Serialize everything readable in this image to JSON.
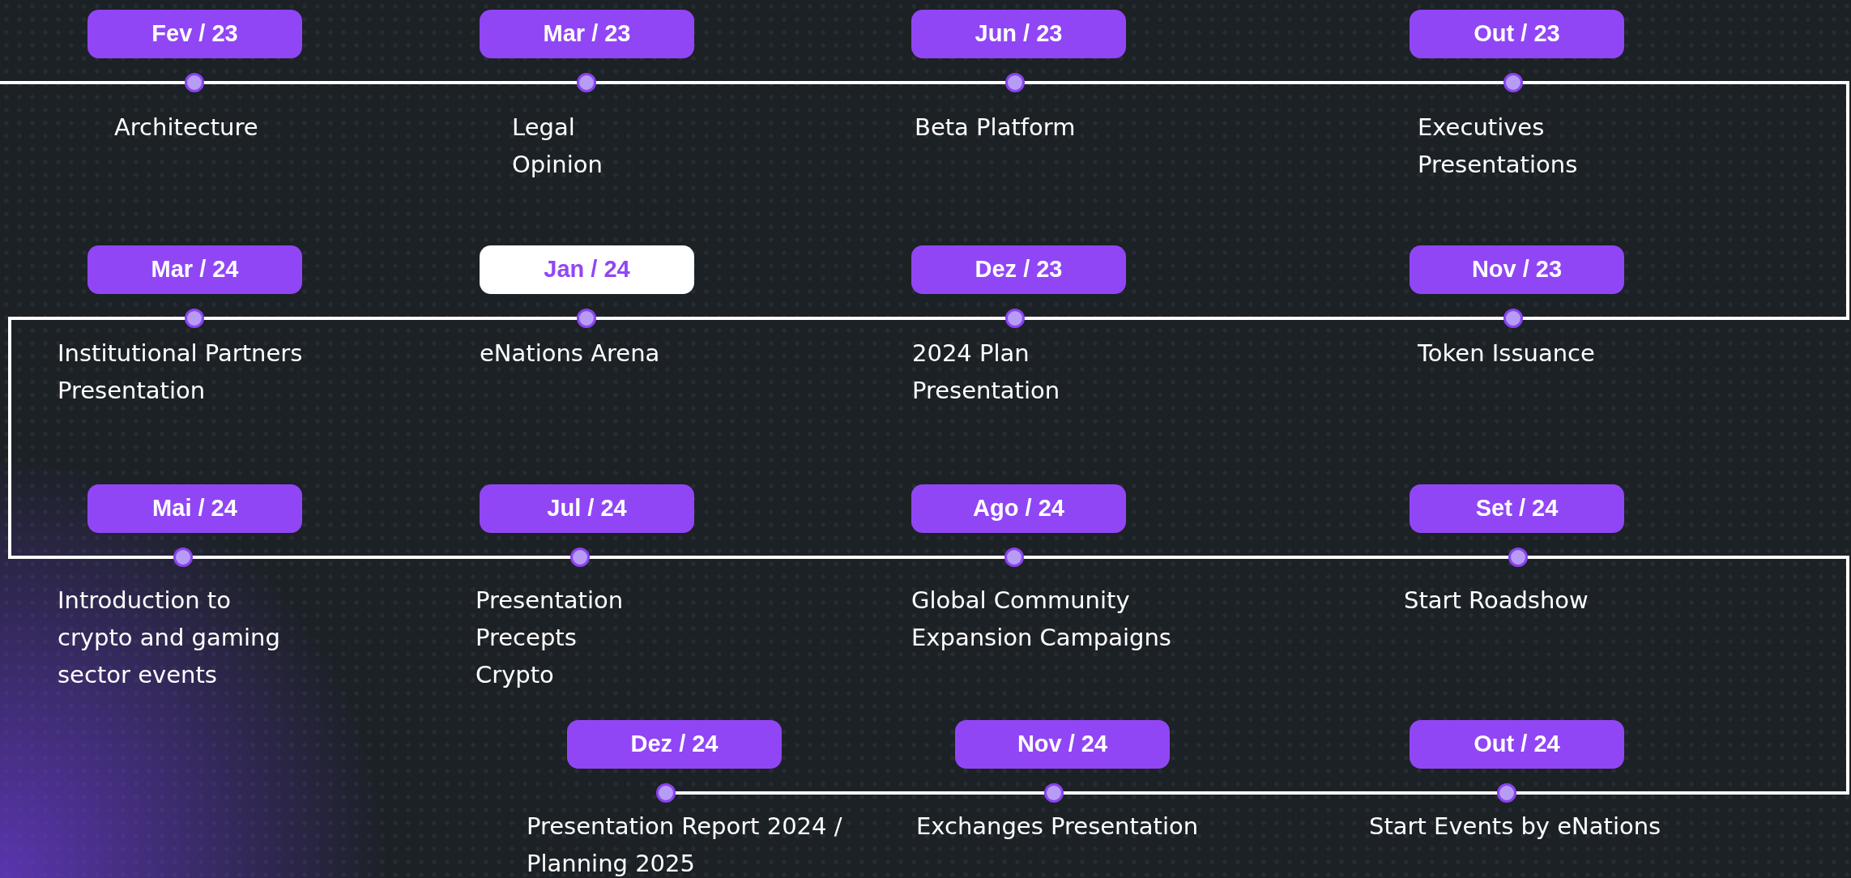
{
  "rows": [
    {
      "milestones": [
        {
          "date": "Fev / 23",
          "label": "Architecture",
          "selected": false
        },
        {
          "date": "Mar / 23",
          "label": "Legal\nOpinion",
          "selected": false
        },
        {
          "date": "Jun / 23",
          "label": "Beta Platform",
          "selected": false
        },
        {
          "date": "Out / 23",
          "label": "Executives\nPresentations",
          "selected": false
        }
      ]
    },
    {
      "milestones": [
        {
          "date": "Mar / 24",
          "label": "Institutional Partners\nPresentation",
          "selected": false
        },
        {
          "date": "Jan / 24",
          "label": "eNations Arena",
          "selected": true
        },
        {
          "date": "Dez / 23",
          "label": "2024 Plan\nPresentation",
          "selected": false
        },
        {
          "date": "Nov / 23",
          "label": "Token Issuance",
          "selected": false
        }
      ]
    },
    {
      "milestones": [
        {
          "date": "Mai / 24",
          "label": "Introduction to\ncrypto and gaming\nsector events",
          "selected": false
        },
        {
          "date": "Jul / 24",
          "label": "Presentation\nPrecepts\nCrypto",
          "selected": false
        },
        {
          "date": "Ago / 24",
          "label": "Global Community\nExpansion Campaigns",
          "selected": false
        },
        {
          "date": "Set / 24",
          "label": "Start Roadshow",
          "selected": false
        }
      ]
    },
    {
      "milestones": [
        {
          "date": "Dez / 24",
          "label": "Presentation Report 2024 /\nPlanning 2025",
          "selected": false
        },
        {
          "date": "Nov / 24",
          "label": "Exchanges Presentation",
          "selected": false
        },
        {
          "date": "Out / 24",
          "label": "Start Events by eNations",
          "selected": false
        }
      ]
    }
  ]
}
